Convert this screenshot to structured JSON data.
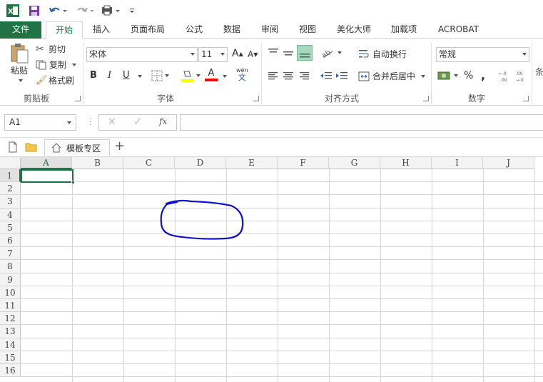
{
  "window": {
    "excel_logo_letter": "X"
  },
  "qat": {
    "icons": [
      "excel-logo-icon",
      "save-icon",
      "undo-icon",
      "redo-icon",
      "print-preview-icon",
      "customize-qat-icon"
    ]
  },
  "tabs": [
    {
      "label": "文件",
      "active": false
    },
    {
      "label": "开始",
      "active": true
    },
    {
      "label": "插入",
      "active": false
    },
    {
      "label": "页面布局",
      "active": false
    },
    {
      "label": "公式",
      "active": false
    },
    {
      "label": "数据",
      "active": false
    },
    {
      "label": "审阅",
      "active": false
    },
    {
      "label": "视图",
      "active": false
    },
    {
      "label": "美化大师",
      "active": false
    },
    {
      "label": "加载项",
      "active": false
    },
    {
      "label": "ACROBAT",
      "active": false
    }
  ],
  "ribbon": {
    "clipboard": {
      "paste_label": "粘贴",
      "cut_label": "剪切",
      "copy_label": "复制",
      "format_painter_label": "格式刷",
      "group_label": "剪贴板"
    },
    "font": {
      "font_name": "宋体",
      "font_size": "11",
      "grow_label": "A",
      "shrink_label": "A",
      "bold_label": "B",
      "italic_label": "I",
      "underline_label": "U",
      "phonetic_label": "wén",
      "phonetic_sub": "文",
      "font_color_letter": "A",
      "group_label": "字体",
      "fill_color": "#ffff00",
      "font_color": "#ff0000"
    },
    "alignment": {
      "wrap_label": "自动换行",
      "merge_label": "合并后居中",
      "group_label": "对齐方式"
    },
    "number": {
      "format": "常规",
      "percent": "%",
      "comma": ",",
      "group_label": "数字"
    },
    "styles_partial_label": "条"
  },
  "formula_bar": {
    "name_box": "A1",
    "fx_label": "fx",
    "formula": ""
  },
  "file_tabs": {
    "template_tab_label": "模板专区",
    "add_label": "+"
  },
  "sheet": {
    "columns": [
      "A",
      "B",
      "C",
      "D",
      "E",
      "F",
      "G",
      "H",
      "I",
      "J"
    ],
    "rows": [
      "1",
      "2",
      "3",
      "4",
      "5",
      "6",
      "7",
      "8",
      "9",
      "10",
      "11",
      "12",
      "13",
      "14",
      "15",
      "16"
    ],
    "selected_cell": "A1",
    "accent_color": "#217346",
    "drawing_color": "#1010c8"
  }
}
